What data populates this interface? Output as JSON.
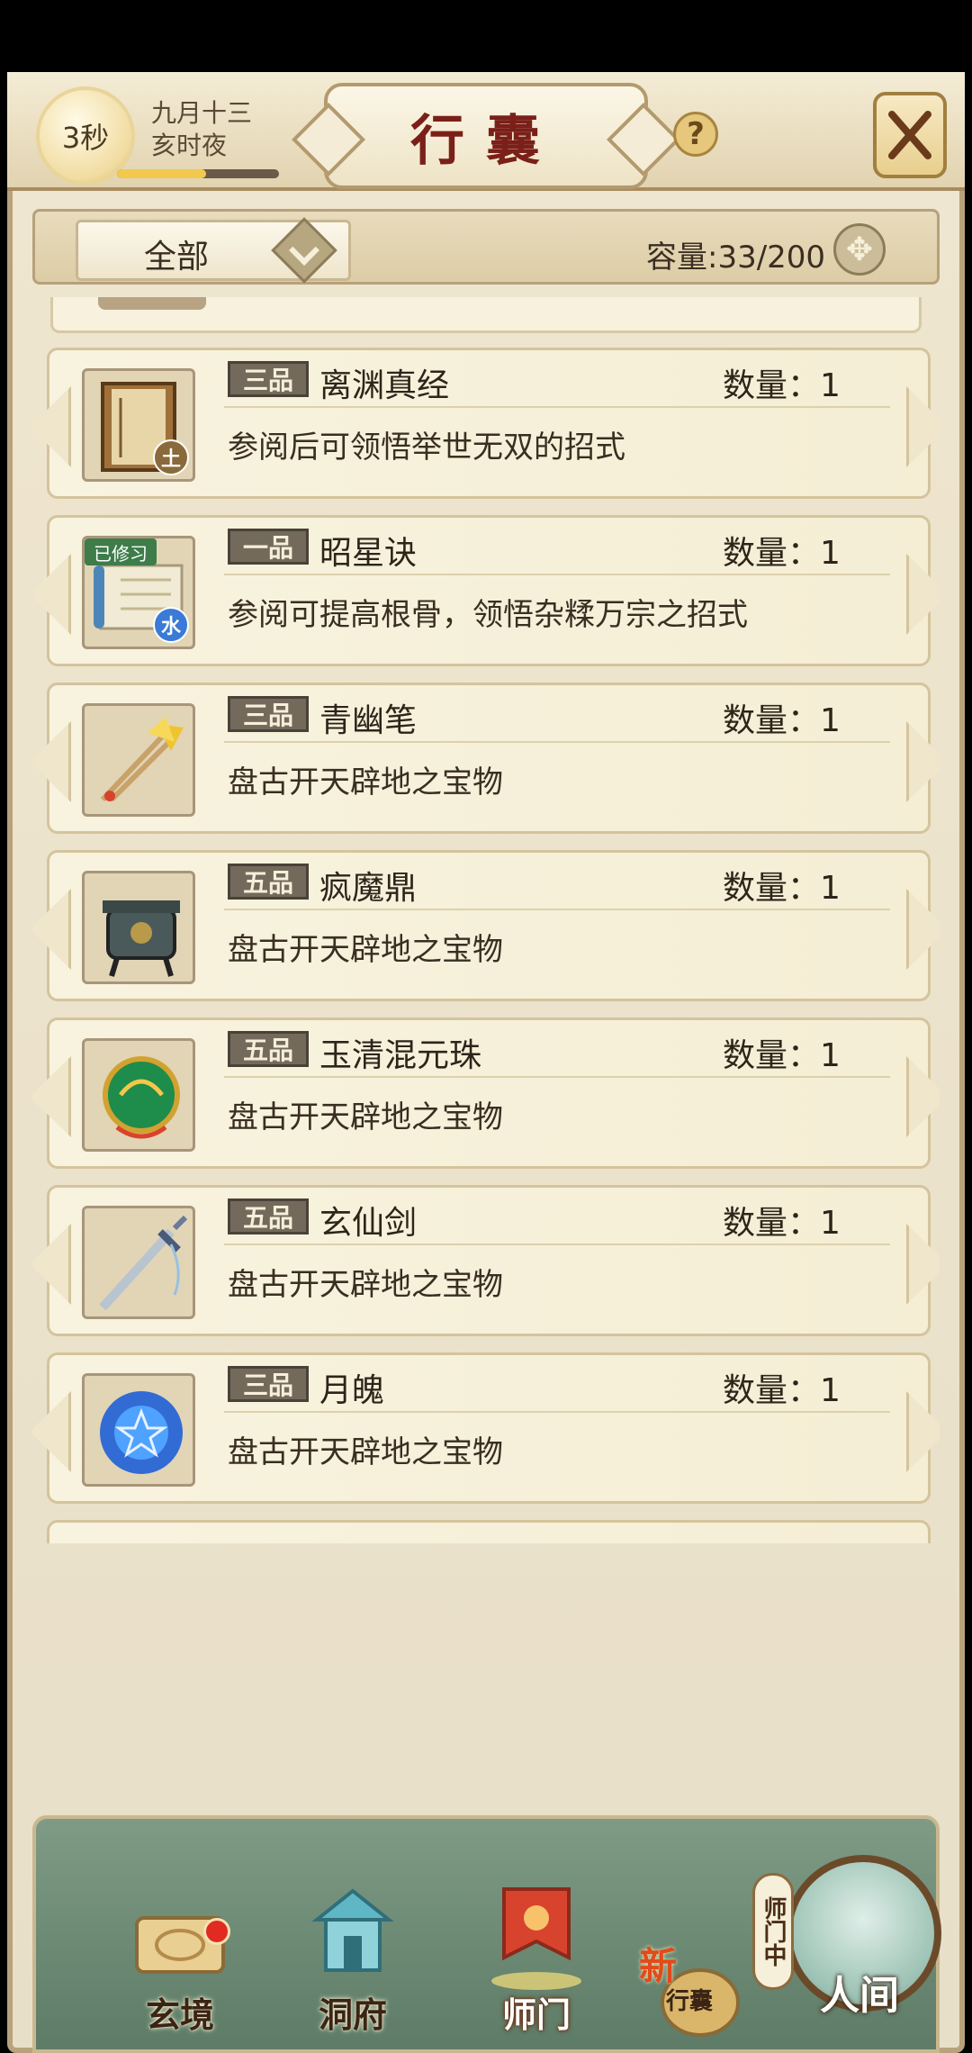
{
  "header": {
    "timer": "3秒",
    "date": "九月十三",
    "time_of_day": "亥时夜",
    "time_progress": 0.55,
    "title": "行囊",
    "help": "?"
  },
  "filter": {
    "selected": "全部",
    "capacity_label": "容量:33/200"
  },
  "items": [
    {
      "grade": "三品",
      "name": "离渊真经",
      "qty": "数量：1",
      "desc": "参阅后可领悟举世无双的招式",
      "icon": "book-icon",
      "element": "土"
    },
    {
      "grade": "一品",
      "name": "昭星诀",
      "qty": "数量：1",
      "desc": "参阅可提高根骨，领悟杂糅万宗之招式",
      "icon": "scroll-icon",
      "tag": "已修习",
      "element": "水"
    },
    {
      "grade": "三品",
      "name": "青幽笔",
      "qty": "数量：1",
      "desc": "盘古开天辟地之宝物",
      "icon": "brush-icon"
    },
    {
      "grade": "五品",
      "name": "疯魔鼎",
      "qty": "数量：1",
      "desc": "盘古开天辟地之宝物",
      "icon": "cauldron-icon"
    },
    {
      "grade": "五品",
      "name": "玉清混元珠",
      "qty": "数量：1",
      "desc": "盘古开天辟地之宝物",
      "icon": "jade-orb-icon"
    },
    {
      "grade": "五品",
      "name": "玄仙剑",
      "qty": "数量：1",
      "desc": "盘古开天辟地之宝物",
      "icon": "sword-icon"
    },
    {
      "grade": "三品",
      "name": "月魄",
      "qty": "数量：1",
      "desc": "盘古开天辟地之宝物",
      "icon": "blue-orb-icon"
    }
  ],
  "nav": {
    "xuanjing": "玄境",
    "dongfu": "洞府",
    "shimen": "师门",
    "bag_new": "新",
    "bag": "行囊",
    "renjian": "人间",
    "shimen_tag": "师门中"
  },
  "colors": {
    "title_red": "#7a2018",
    "grade_badge": "#746a5c",
    "panel_bg": "#efe6d0",
    "nav_green": "#6b8a74"
  }
}
